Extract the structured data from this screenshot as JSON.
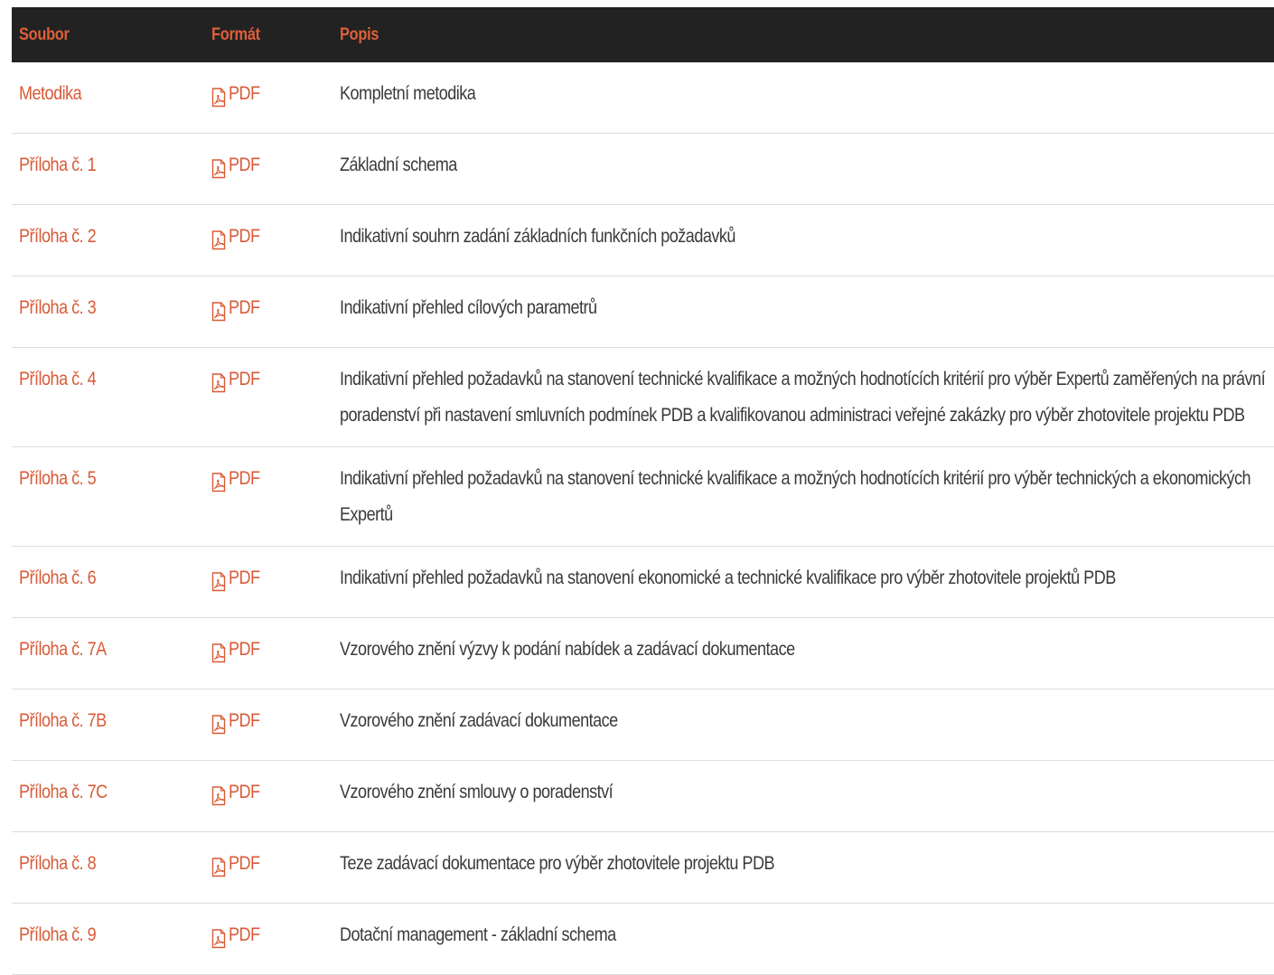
{
  "table": {
    "headers": {
      "file": "Soubor",
      "format": "Formát",
      "description": "Popis"
    },
    "rows": [
      {
        "file": "Metodika",
        "format": "PDF",
        "icon": "pdf-file-icon",
        "description": "Kompletní metodika"
      },
      {
        "file": "Příloha č. 1",
        "format": "PDF",
        "icon": "pdf-file-icon",
        "description": "Základní schema"
      },
      {
        "file": "Příloha č. 2",
        "format": "PDF",
        "icon": "pdf-file-icon",
        "description": "Indikativní souhrn zadání základních funkčních požadavků"
      },
      {
        "file": "Příloha č. 3",
        "format": "PDF",
        "icon": "pdf-file-icon",
        "description": "Indikativní přehled cílových parametrů"
      },
      {
        "file": "Příloha č. 4",
        "format": "PDF",
        "icon": "pdf-file-icon",
        "description": "Indikativní přehled požadavků na stanovení technické kvalifikace a možných hodnotících kritérií pro výběr Expertů zaměřených na právní poradenství při nastavení smluvních podmínek PDB a kvalifikovanou administraci veřejné zakázky pro výběr zhotovitele projektu PDB"
      },
      {
        "file": "Příloha č. 5",
        "format": "PDF",
        "icon": "pdf-file-icon",
        "description": "Indikativní přehled požadavků na stanovení technické kvalifikace a možných hodnotících kritérií pro výběr technických a ekonomických Expertů"
      },
      {
        "file": "Příloha č. 6",
        "format": "PDF",
        "icon": "pdf-file-icon",
        "description": "Indikativní přehled požadavků na stanovení ekonomické a technické kvalifikace pro výběr zhotovitele projektů PDB"
      },
      {
        "file": "Příloha č. 7A",
        "format": "PDF",
        "icon": "pdf-file-icon",
        "description": "Vzorového znění výzvy k podání nabídek a zadávací dokumentace"
      },
      {
        "file": "Příloha č. 7B",
        "format": "PDF",
        "icon": "pdf-file-icon",
        "description": "Vzorového znění zadávací dokumentace"
      },
      {
        "file": "Příloha č. 7C",
        "format": "PDF",
        "icon": "pdf-file-icon",
        "description": "Vzorového znění smlouvy o poradenství"
      },
      {
        "file": "Příloha č. 8",
        "format": "PDF",
        "icon": "pdf-file-icon",
        "description": "Teze zadávací dokumentace pro výběr zhotovitele projektu PDB"
      },
      {
        "file": "Příloha č. 9",
        "format": "PDF",
        "icon": "pdf-file-icon",
        "description": "Dotační management - základní schema"
      }
    ]
  },
  "colors": {
    "accent": "#d95a37",
    "header_bg": "#222222",
    "text": "#3a3a3a"
  }
}
